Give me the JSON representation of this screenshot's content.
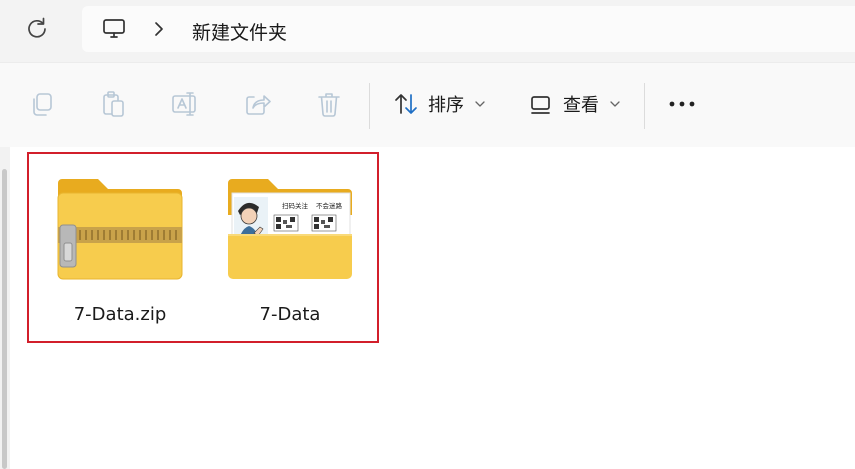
{
  "address": {
    "refresh_icon": "refresh-icon",
    "location_icon": "computer-icon",
    "separator_icon": "chevron-right-icon",
    "breadcrumb": "新建文件夹"
  },
  "toolbar": {
    "icons": [
      "copy-icon",
      "paste-icon",
      "rename-icon",
      "share-icon",
      "delete-icon"
    ],
    "sort_label": "排序",
    "view_label": "查看",
    "more_icon": "more-icon"
  },
  "files": [
    {
      "name": "7-Data.zip",
      "icon": "zip-folder-icon"
    },
    {
      "name": "7-Data",
      "icon": "folder-icon"
    }
  ],
  "thumbnail_text": [
    "扫码关注",
    "不会迷路"
  ],
  "colors": {
    "folder": "#f5c443",
    "folder_dark": "#e8ab1f",
    "highlight": "#d21f2b"
  }
}
